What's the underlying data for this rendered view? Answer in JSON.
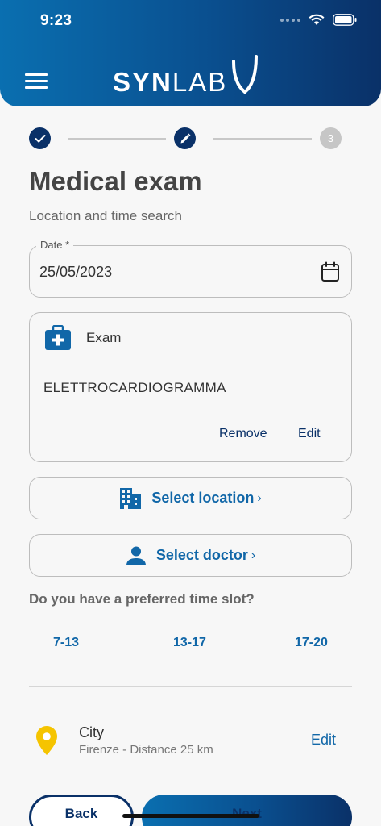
{
  "status_bar": {
    "time": "9:23"
  },
  "header": {
    "logo_bold": "SYN",
    "logo_light": "LAB",
    "menu_icon": "hamburger-menu-icon"
  },
  "stepper": {
    "steps": [
      {
        "state": "done",
        "icon": "check-icon"
      },
      {
        "state": "current",
        "icon": "pencil-icon"
      },
      {
        "state": "todo",
        "label": "3"
      }
    ]
  },
  "page": {
    "title": "Medical exam",
    "subtitle": "Location and time search"
  },
  "date_field": {
    "label": "Date *",
    "value": "25/05/2023",
    "icon": "calendar-icon"
  },
  "exam_card": {
    "heading": "Exam",
    "name": "ELETTROCARDIOGRAMMA",
    "remove_label": "Remove",
    "edit_label": "Edit",
    "icon": "medical-kit-icon"
  },
  "select_location": {
    "label": "Select location",
    "chevron": "›",
    "icon": "building-icon"
  },
  "select_doctor": {
    "label": "Select doctor",
    "chevron": "›",
    "icon": "person-icon"
  },
  "time_slots": {
    "question": "Do you have a preferred time slot?",
    "options": [
      "7-13",
      "13-17",
      "17-20"
    ]
  },
  "city": {
    "label": "City",
    "detail": "Firenze - Distance 25 km",
    "edit_label": "Edit",
    "icon": "location-pin-icon"
  },
  "footer": {
    "back_label": "Back",
    "next_label": "Next"
  },
  "colors": {
    "brand_dark": "#0a3168",
    "brand_blue": "#1167a8",
    "pin_yellow": "#f5c400"
  }
}
